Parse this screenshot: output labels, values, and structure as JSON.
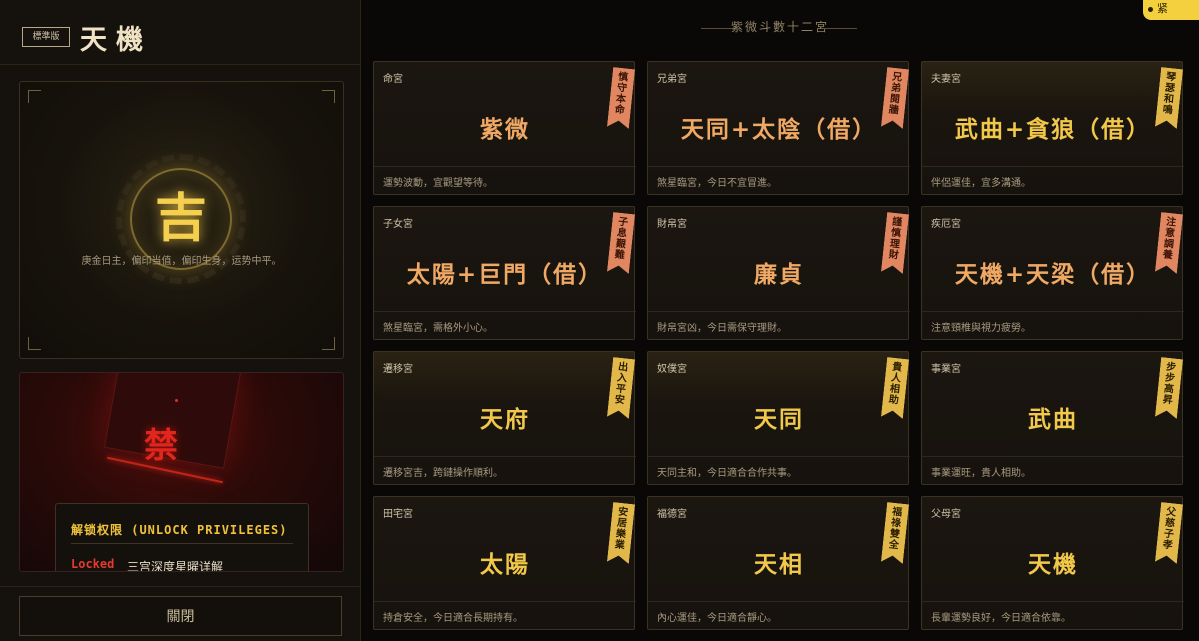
{
  "header": {
    "edition_badge": "標準版",
    "title": "天機"
  },
  "fortune": {
    "symbol": "吉",
    "description": "庚金日主，偏印当值，偏印生身，运势中平。"
  },
  "locked_panel": {
    "stamp_char": "禁",
    "title": "解锁权限 (UNLOCK PRIVILEGES)",
    "status": "Locked",
    "feature": "三宫深度星曜详解"
  },
  "close_button": "關閉",
  "corner_badge": "紧",
  "grid": {
    "title": "紫微斗數十二宮",
    "palaces": [
      {
        "name": "命宮",
        "stars": "紫微",
        "desc": "運勢波動，宜觀望等待。",
        "tag": "慎守本命",
        "tone": "orange"
      },
      {
        "name": "兄弟宮",
        "stars": "天同+太陰（借）",
        "desc": "煞星臨宮，今日不宜冒進。",
        "tag": "兄弟閱牆",
        "tone": "orange"
      },
      {
        "name": "夫妻宮",
        "stars": "武曲+貪狼（借）",
        "desc": "伴侶運佳，宜多溝通。",
        "tag": "琴瑟和鳴",
        "tone": "gold"
      },
      {
        "name": "子女宮",
        "stars": "太陽+巨門（借）",
        "desc": "煞星臨宮，需格外小心。",
        "tag": "子息艱難",
        "tone": "orange"
      },
      {
        "name": "財帛宮",
        "stars": "廉貞",
        "desc": "財帛宮凶，今日需保守理財。",
        "tag": "謹慎理財",
        "tone": "orange"
      },
      {
        "name": "疾厄宮",
        "stars": "天機+天梁（借）",
        "desc": "注意頸椎與視力疲勞。",
        "tag": "注意調養",
        "tone": "orange"
      },
      {
        "name": "遷移宮",
        "stars": "天府",
        "desc": "遷移宮吉，跨鏈操作順利。",
        "tag": "出入平安",
        "tone": "gold"
      },
      {
        "name": "奴僕宮",
        "stars": "天同",
        "desc": "天同主和，今日適合合作共事。",
        "tag": "貴人相助",
        "tone": "gold"
      },
      {
        "name": "事業宮",
        "stars": "武曲",
        "desc": "事業運旺，貴人相助。",
        "tag": "步步高昇",
        "tone": "gold"
      },
      {
        "name": "田宅宮",
        "stars": "太陽",
        "desc": "持倉安全，今日適合長期持有。",
        "tag": "安居樂業",
        "tone": "gold"
      },
      {
        "name": "福德宮",
        "stars": "天相",
        "desc": "內心運佳，今日適合靜心。",
        "tag": "福祿雙全",
        "tone": "gold"
      },
      {
        "name": "父母宮",
        "stars": "天機",
        "desc": "長輩運勢良好，今日適合依靠。",
        "tag": "父慈子孝",
        "tone": "gold"
      }
    ]
  },
  "colors": {
    "gold": "#f2c84a",
    "orange": "#f0a865",
    "locked_red": "#e53a2e",
    "background": "#0b0906"
  }
}
